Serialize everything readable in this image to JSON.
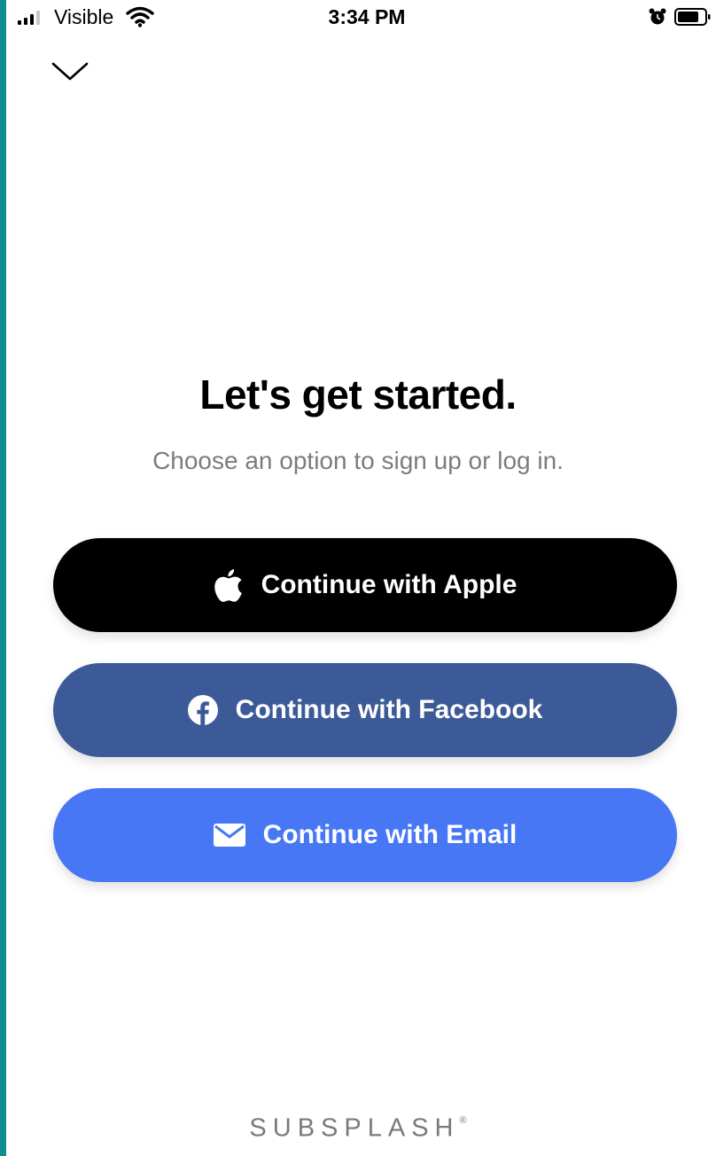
{
  "status_bar": {
    "carrier": "Visible",
    "time": "3:34 PM",
    "icons": [
      "signal-icon",
      "wifi-icon",
      "alarm-icon",
      "battery-icon"
    ]
  },
  "header": {
    "dismiss_icon": "chevron-down-icon"
  },
  "main": {
    "title": "Let's get started.",
    "subtitle": "Choose an option to sign up or log in.",
    "buttons": [
      {
        "label": "Continue with Apple",
        "icon": "apple-icon",
        "color": "#000000"
      },
      {
        "label": "Continue with Facebook",
        "icon": "facebook-icon",
        "color": "#3d5a98"
      },
      {
        "label": "Continue with Email",
        "icon": "envelope-icon",
        "color": "#4777f4"
      }
    ]
  },
  "footer": {
    "brand": "SUBSPLASH",
    "mark": "®"
  },
  "colors": {
    "text_primary": "#000000",
    "text_secondary": "#7c7c7c",
    "background": "#ffffff"
  }
}
